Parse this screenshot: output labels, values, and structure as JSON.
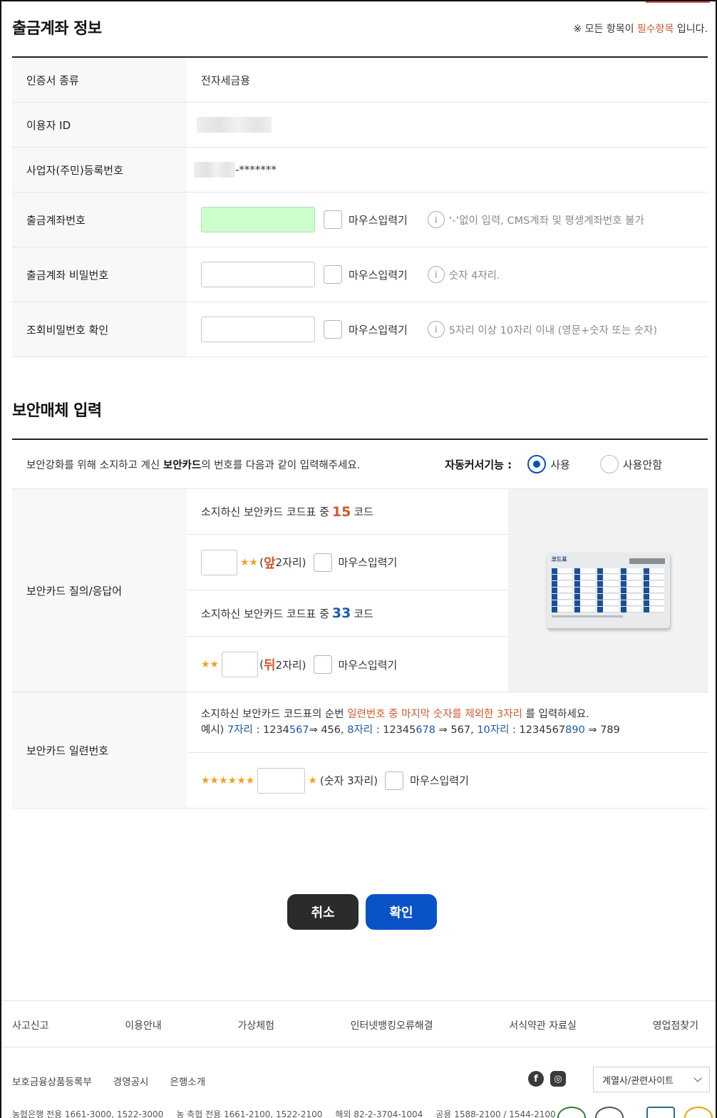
{
  "section1": {
    "title": "출금계좌 정보",
    "required_note_prefix": "※ 모든 항목이 ",
    "required_note_highlight": "필수항목",
    "required_note_suffix": " 입니다."
  },
  "account_form": {
    "rows": [
      {
        "label": "인증서 종류",
        "value": "전자세금용"
      },
      {
        "label": "이용자 ID",
        "value": ""
      },
      {
        "label": "사업자(주민)등록번호",
        "value": "-*******"
      },
      {
        "label": "출금계좌번호",
        "mouse_label": "마우스입력기",
        "info": "‘-’없이 입력, CMS계좌 및 평생계좌번호 불가"
      },
      {
        "label": "출금계좌 비밀번호",
        "mouse_label": "마우스입력기",
        "info": "숫자 4자리."
      },
      {
        "label": "조회비밀번호 확인",
        "mouse_label": "마우스입력기",
        "info": "5자리 이상 10자리 이내 (영문+숫자 또는 숫자)"
      }
    ]
  },
  "section2": {
    "title": "보안매체 입력",
    "guide_prefix": "보안강화를 위해 소지하고 계신 ",
    "guide_bold": "보안카드",
    "guide_suffix": "의 번호를 다음과 같이 입력해주세요.",
    "auto_cursor_label": "자동커서기능 :",
    "auto_cursor_options": [
      "사용",
      "사용안함"
    ],
    "auto_cursor_selected": "사용"
  },
  "security_card": {
    "label": "보안카드 질의/응답어",
    "q1_prefix": "소지하신 보안카드 코드표 중",
    "q1_number": "15",
    "q1_suffix": "코드",
    "a1_stars": "★★",
    "a1_open": "(",
    "a1_highlight": "앞",
    "a1_rest": "2자리)",
    "q2_prefix": "소지하신 보안카드 코드표 중",
    "q2_number": "33",
    "q2_suffix": "코드",
    "a2_stars": "★★",
    "a2_open": "(",
    "a2_highlight": "뒤",
    "a2_rest": "2자리)",
    "mouse_label": "마우스입력기",
    "card_image_title": "코드표"
  },
  "serial": {
    "label": "보안카드 일련번호",
    "desc_prefix": "소지하신 보안카드 코드표의 순번 ",
    "desc_highlight": "일련번호 중 마지막 숫자를 제외한 3자리",
    "desc_suffix": " 를 입력하세요.",
    "ex_prefix": "예시) ",
    "ex1_len": "7자리",
    "ex1_a": " : 1234",
    "ex1_b": "567",
    "ex1_c": "⇒ 456, ",
    "ex2_len": "8자리",
    "ex2_a": " : 12345",
    "ex2_b": "678",
    "ex2_c": " ⇒ 567, ",
    "ex3_len": "10자리",
    "ex3_a": " : 1234567",
    "ex3_b": "890",
    "ex3_c": " ⇒ 789",
    "stars_before": "★★★★★★",
    "stars_after": "★",
    "hint": "(숫자 3자리)",
    "mouse_label": "마우스입력기"
  },
  "buttons": {
    "cancel": "취소",
    "confirm": "확인"
  },
  "footer": {
    "nav": [
      "사고신고",
      "이용안내",
      "가상체험",
      "인터넷뱅킹오류해결",
      "서식약관 자료실",
      "영업점찾기"
    ],
    "links": [
      "보호금융상품등록부",
      "경영공시",
      "은행소개"
    ],
    "sns": [
      "f",
      "◎"
    ],
    "family_select": "계열사/관련사이트",
    "phones": [
      "농협은행 전용 1661-3000, 1522-3000",
      "농 축협 전용 1661-2100, 1522-2100",
      "해외 82-2-3704-1004",
      "공용 1588-2100 / 1544-2100"
    ]
  },
  "colors": {
    "accent_blue": "#0a52c7",
    "highlight_orange": "#d05a2c",
    "input_green": "#ccffcc",
    "dark_button": "#2b2b2b"
  }
}
